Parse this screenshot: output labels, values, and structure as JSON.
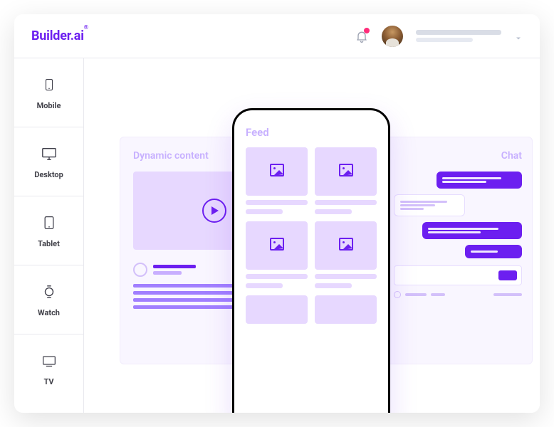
{
  "logo": "Builder.ai",
  "logo_trademark": "®",
  "sidebar": {
    "items": [
      {
        "label": "Mobile"
      },
      {
        "label": "Desktop"
      },
      {
        "label": "Tablet"
      },
      {
        "label": "Watch"
      },
      {
        "label": "TV"
      }
    ]
  },
  "canvas": {
    "left_panel_title": "Dynamic content",
    "right_panel_title": "Chat",
    "phone_title": "Feed"
  }
}
